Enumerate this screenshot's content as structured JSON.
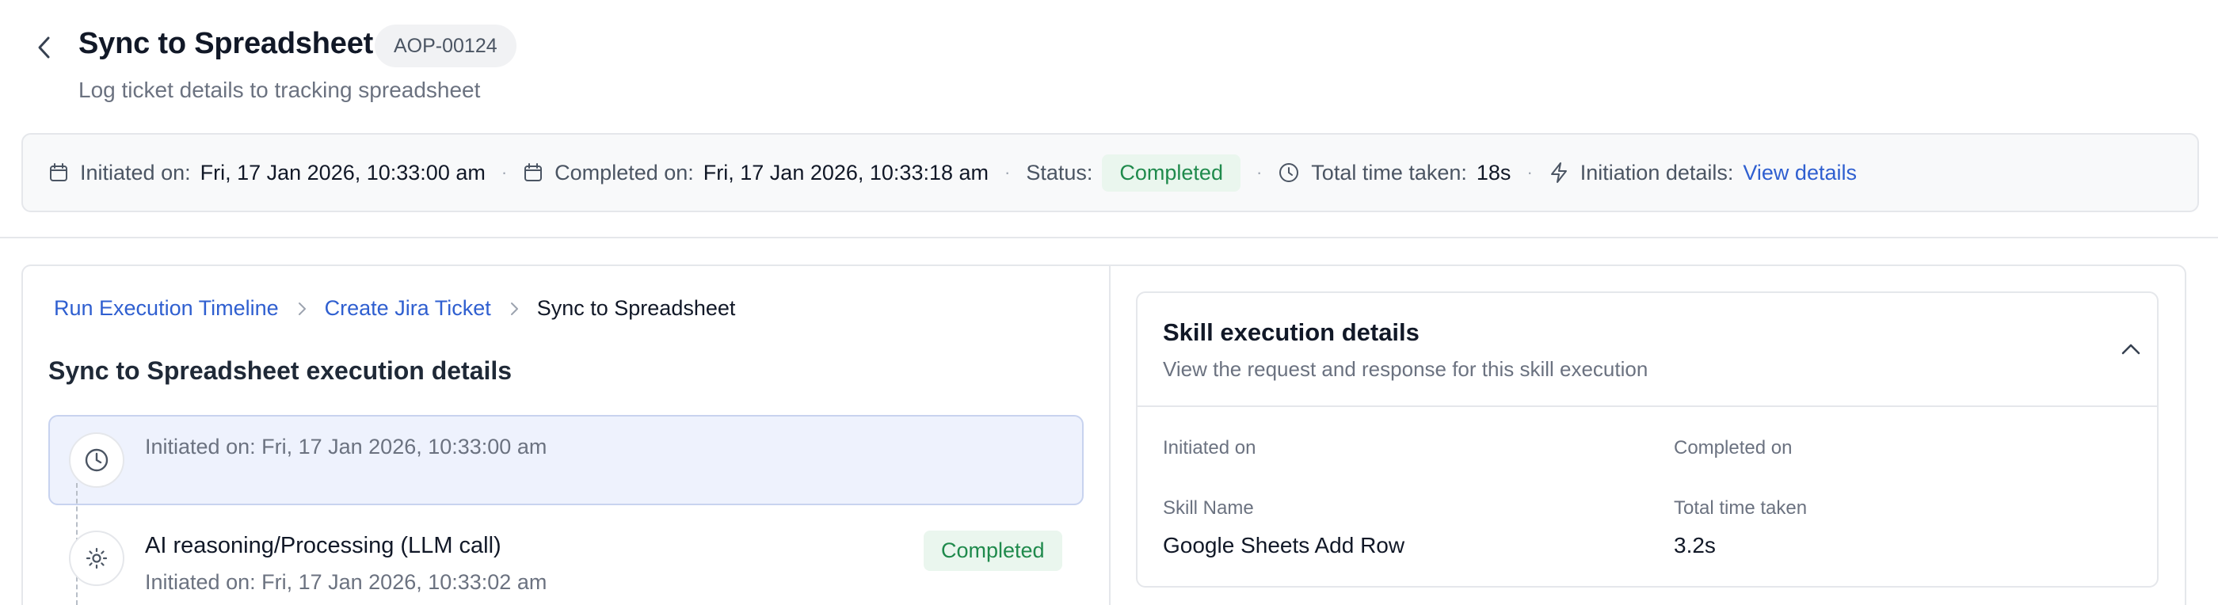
{
  "header": {
    "title": "Sync to Spreadsheet",
    "id_badge": "AOP-00124",
    "subtitle": "Log ticket details to tracking spreadsheet"
  },
  "info_bar": {
    "initiated_label": "Initiated on:",
    "initiated_value": "Fri, 17 Jan 2026, 10:33:00 am",
    "completed_label": "Completed on:",
    "completed_value": "Fri, 17 Jan 2026, 10:33:18 am",
    "status_label": "Status:",
    "status_value": "Completed",
    "time_label": "Total time taken:",
    "time_value": "18s",
    "initiation_label": "Initiation details:",
    "initiation_link": "View details",
    "separator": "·"
  },
  "breadcrumb": {
    "items": [
      "Run Execution Timeline",
      "Create Jira Ticket",
      "Sync to Spreadsheet"
    ]
  },
  "execution": {
    "title": "Sync to Spreadsheet execution details",
    "steps": [
      {
        "text": "Initiated on: Fri, 17 Jan 2026, 10:33:00 am"
      },
      {
        "title": "AI reasoning/Processing (LLM call)",
        "text": "Initiated on: Fri, 17 Jan 2026, 10:33:02 am",
        "status": "Completed"
      }
    ]
  },
  "skill_details": {
    "title": "Skill execution details",
    "subtitle": "View the request and response for this skill execution",
    "initiated_label": "Initiated on",
    "completed_label": "Completed on",
    "skill_name_label": "Skill Name",
    "skill_name_value": "Google Sheets Add Row",
    "time_label": "Total time taken",
    "time_value": "3.2s"
  },
  "colors": {
    "link": "#2f5fd0",
    "success_text": "#1f8a4c",
    "success_bg": "#eaf6ee",
    "active_step_bg": "#eef2fd"
  },
  "icons": [
    "chevron-left-icon",
    "calendar-icon",
    "clock-icon",
    "lightning-icon",
    "chevron-right-icon",
    "settings-icon",
    "chevron-up-icon"
  ]
}
